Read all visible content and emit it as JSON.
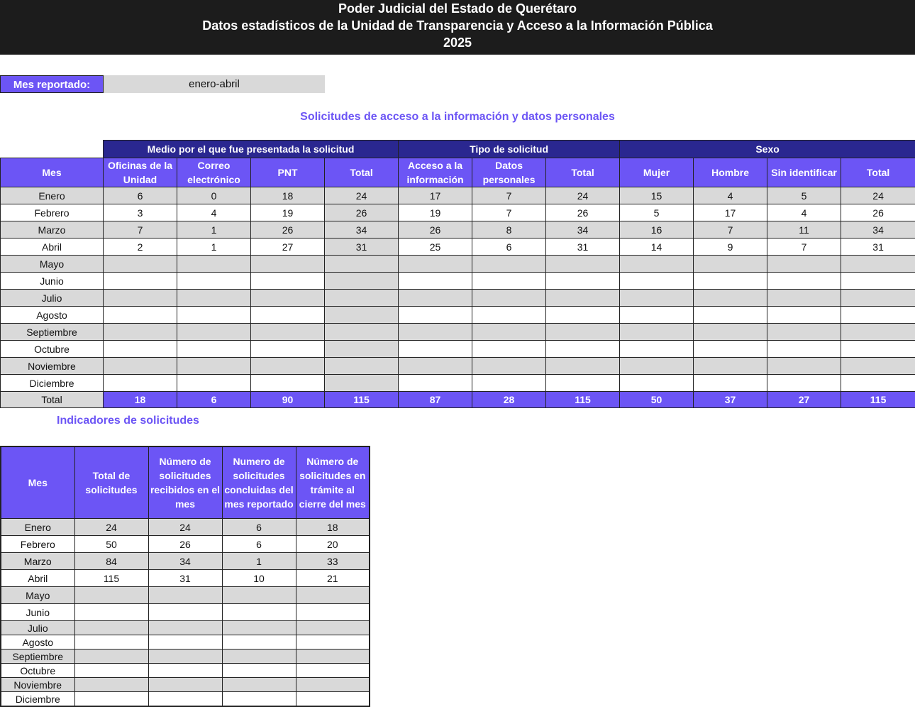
{
  "header": {
    "line1": "Poder Judicial del Estado de Querétaro",
    "line2": "Datos estadísticos de la Unidad de Transparencia y Acceso a la Información Pública",
    "line3": "2025"
  },
  "mes_reportado": {
    "label": "Mes reportado:",
    "value": "enero-abril"
  },
  "section1_title": "Solicitudes de acceso a la información y datos personales",
  "table1": {
    "groups": [
      "Medio por el que fue presentada la solicitud",
      "Tipo de solicitud",
      "Sexo"
    ],
    "columns": [
      "Mes",
      "Oficinas de la Unidad",
      "Correo electrónico",
      "PNT",
      "Total",
      "Acceso a la información",
      "Datos personales",
      "Total",
      "Mujer",
      "Hombre",
      "Sin identificar",
      "Total"
    ],
    "rows": [
      [
        "Enero",
        "6",
        "0",
        "18",
        "24",
        "17",
        "7",
        "24",
        "15",
        "4",
        "5",
        "24"
      ],
      [
        "Febrero",
        "3",
        "4",
        "19",
        "26",
        "19",
        "7",
        "26",
        "5",
        "17",
        "4",
        "26"
      ],
      [
        "Marzo",
        "7",
        "1",
        "26",
        "34",
        "26",
        "8",
        "34",
        "16",
        "7",
        "11",
        "34"
      ],
      [
        "Abril",
        "2",
        "1",
        "27",
        "31",
        "25",
        "6",
        "31",
        "14",
        "9",
        "7",
        "31"
      ],
      [
        "Mayo",
        "",
        "",
        "",
        "",
        "",
        "",
        "",
        "",
        "",
        "",
        ""
      ],
      [
        "Junio",
        "",
        "",
        "",
        "",
        "",
        "",
        "",
        "",
        "",
        "",
        ""
      ],
      [
        "Julio",
        "",
        "",
        "",
        "",
        "",
        "",
        "",
        "",
        "",
        "",
        ""
      ],
      [
        "Agosto",
        "",
        "",
        "",
        "",
        "",
        "",
        "",
        "",
        "",
        "",
        ""
      ],
      [
        "Septiembre",
        "",
        "",
        "",
        "",
        "",
        "",
        "",
        "",
        "",
        "",
        ""
      ],
      [
        "Octubre",
        "",
        "",
        "",
        "",
        "",
        "",
        "",
        "",
        "",
        "",
        ""
      ],
      [
        "Noviembre",
        "",
        "",
        "",
        "",
        "",
        "",
        "",
        "",
        "",
        "",
        ""
      ],
      [
        "Diciembre",
        "",
        "",
        "",
        "",
        "",
        "",
        "",
        "",
        "",
        "",
        ""
      ]
    ],
    "total_row": [
      "Total",
      "18",
      "6",
      "90",
      "115",
      "87",
      "28",
      "115",
      "50",
      "37",
      "27",
      "115"
    ]
  },
  "section2_title": "Indicadores de solicitudes",
  "table2": {
    "columns": [
      "Mes",
      "Total de solicitudes",
      "Número de solicitudes recibidos en el mes",
      "Numero de solicitudes concluidas del mes reportado",
      "Número de solicitudes en trámite al cierre del mes"
    ],
    "rows": [
      [
        "Enero",
        "24",
        "24",
        "6",
        "18"
      ],
      [
        "Febrero",
        "50",
        "26",
        "6",
        "20"
      ],
      [
        "Marzo",
        "84",
        "34",
        "1",
        "33"
      ],
      [
        "Abril",
        "115",
        "31",
        "10",
        "21"
      ],
      [
        "Mayo",
        "",
        "",
        "",
        ""
      ],
      [
        "Junio",
        "",
        "",
        "",
        ""
      ],
      [
        "Julio",
        "",
        "",
        "",
        ""
      ],
      [
        "Agosto",
        "",
        "",
        "",
        ""
      ],
      [
        "Septiembre",
        "",
        "",
        "",
        ""
      ],
      [
        "Octubre",
        "",
        "",
        "",
        ""
      ],
      [
        "Noviembre",
        "",
        "",
        "",
        ""
      ],
      [
        "Diciembre",
        "",
        "",
        "",
        ""
      ]
    ]
  }
}
